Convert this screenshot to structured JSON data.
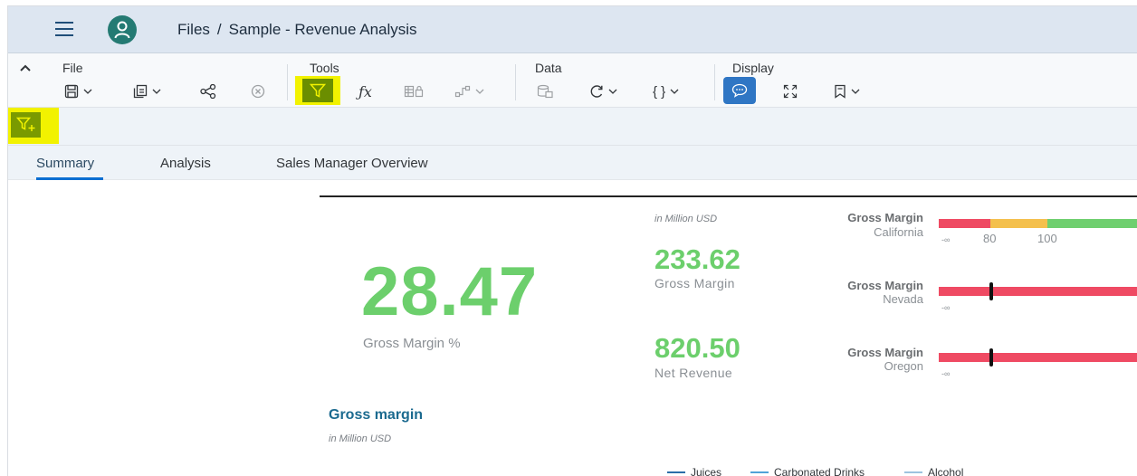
{
  "shell": {
    "breadcrumb_root": "Files",
    "breadcrumb_separator": "/",
    "breadcrumb_current": "Sample - Revenue Analysis"
  },
  "toolbar": {
    "groups": {
      "file": "File",
      "tools": "Tools",
      "data": "Data",
      "display": "Display"
    },
    "icons": [
      "save-icon",
      "copy-icon",
      "share-icon",
      "delete-icon",
      "filter-icon",
      "formula-icon",
      "table-icon",
      "link-icon",
      "data-source-icon",
      "refresh-icon",
      "braces-icon",
      "comment-icon",
      "fullscreen-icon",
      "bookmark-icon"
    ],
    "highlight_color": "#f2f200"
  },
  "filterbar": {
    "icons": [
      "add-filter-icon"
    ]
  },
  "tabs": [
    {
      "label": "Summary",
      "active": true
    },
    {
      "label": "Analysis",
      "active": false
    },
    {
      "label": "Sales Manager Overview",
      "active": false
    }
  ],
  "kpis": {
    "gross_margin_pct": {
      "value": "28.47",
      "label": "Gross Margin %"
    },
    "unit_note": "in Million USD",
    "gross_margin": {
      "value": "233.62",
      "label": "Gross Margin"
    },
    "net_revenue": {
      "value": "820.50",
      "label": "Net Revenue"
    }
  },
  "bullets": [
    {
      "title": "Gross Margin",
      "region": "California",
      "ticks": [
        "-∞",
        "80",
        "100"
      ],
      "bands": [
        "#ef4a63",
        "#f4c04d",
        "#6fcf6f"
      ]
    },
    {
      "title": "Gross Margin",
      "region": "Nevada",
      "ticks": [
        "-∞"
      ],
      "bands": [
        "#ef4a63"
      ]
    },
    {
      "title": "Gross Margin",
      "region": "Oregon",
      "ticks": [
        "-∞"
      ],
      "bands": [
        "#ef4a63"
      ]
    }
  ],
  "section": {
    "title": "Gross margin",
    "unit_note": "in Million USD"
  },
  "legend": [
    {
      "name": "Juices",
      "color": "#2b6ea8"
    },
    {
      "name": "Carbonated Drinks",
      "color": "#4fa3d8"
    },
    {
      "name": "Alcohol",
      "color": "#9cc3df"
    }
  ],
  "colors": {
    "kpi_green": "#6ccf6c",
    "accent_blue": "#0a6ed1",
    "avatar_teal": "#247a73"
  }
}
